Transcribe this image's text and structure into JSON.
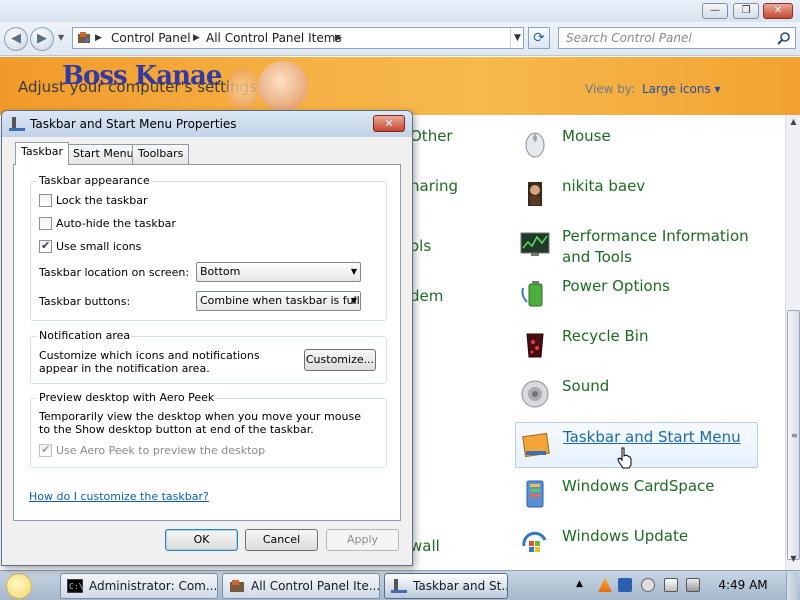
{
  "window": {
    "minimize_glyph": "—",
    "maximize_glyph": "❐",
    "close_glyph": "✕"
  },
  "navbar": {
    "back_glyph": "◀",
    "forward_glyph": "▶",
    "breadcrumb": [
      "Control Panel",
      "All Control Panel Items"
    ],
    "refresh_glyph": "⟳",
    "search_placeholder": "Search Control Panel"
  },
  "banner": {
    "logo_text": "Boss Kanae",
    "subtitle": "Adjust your computer's settings",
    "view_by_label": "View by:",
    "view_by_value": "Large icons ▾"
  },
  "left_column_fragments": [
    "Other",
    "haring",
    "ols",
    "dem",
    "wall"
  ],
  "items": [
    {
      "label": "Mouse",
      "icon": "mouse-icon"
    },
    {
      "label": "nikita baev",
      "icon": "user-icon"
    },
    {
      "label": "Performance Information and Tools",
      "icon": "performance-icon"
    },
    {
      "label": "Power Options",
      "icon": "battery-icon"
    },
    {
      "label": "Recycle Bin",
      "icon": "recycle-bin-icon"
    },
    {
      "label": "Sound",
      "icon": "speaker-icon"
    },
    {
      "label": "Taskbar and Start Menu",
      "icon": "taskbar-icon",
      "hovered": true
    },
    {
      "label": "Windows CardSpace",
      "icon": "cardspace-icon"
    },
    {
      "label": "Windows Update",
      "icon": "windows-update-icon"
    }
  ],
  "dialog": {
    "title": "Taskbar and Start Menu Properties",
    "tabs": [
      "Taskbar",
      "Start Menu",
      "Toolbars"
    ],
    "appearance": {
      "title": "Taskbar appearance",
      "lock_label": "Lock the taskbar",
      "lock_checked": false,
      "autohide_label": "Auto-hide the taskbar",
      "autohide_checked": false,
      "small_icons_label": "Use small icons",
      "small_icons_checked": true,
      "location_label": "Taskbar location on screen:",
      "location_value": "Bottom",
      "buttons_label": "Taskbar buttons:",
      "buttons_value": "Combine when taskbar is full"
    },
    "notification": {
      "title": "Notification area",
      "description": "Customize which icons and notifications appear in the notification area.",
      "customize_button": "Customize..."
    },
    "peek": {
      "title": "Preview desktop with Aero Peek",
      "description": "Temporarily view the desktop when you move your mouse to the Show desktop button at end of the taskbar.",
      "checkbox_label": "Use Aero Peek to preview the desktop",
      "checked": true
    },
    "help_link": "How do I customize the taskbar?",
    "ok": "OK",
    "cancel": "Cancel",
    "apply": "Apply"
  },
  "taskbar": {
    "buttons": [
      {
        "label": "Administrator: Com...",
        "icon": "cmd-icon"
      },
      {
        "label": "All Control Panel Ite...",
        "icon": "control-panel-icon"
      },
      {
        "label": "Taskbar and St...",
        "icon": "taskbar-icon",
        "active": true
      }
    ],
    "tray_expand_glyph": "▲",
    "time": "4:49 AM"
  },
  "colors": {
    "link_green": "#1d6b22",
    "banner_orange": "#f6b245",
    "help_link_blue": "#0b5fb3"
  }
}
